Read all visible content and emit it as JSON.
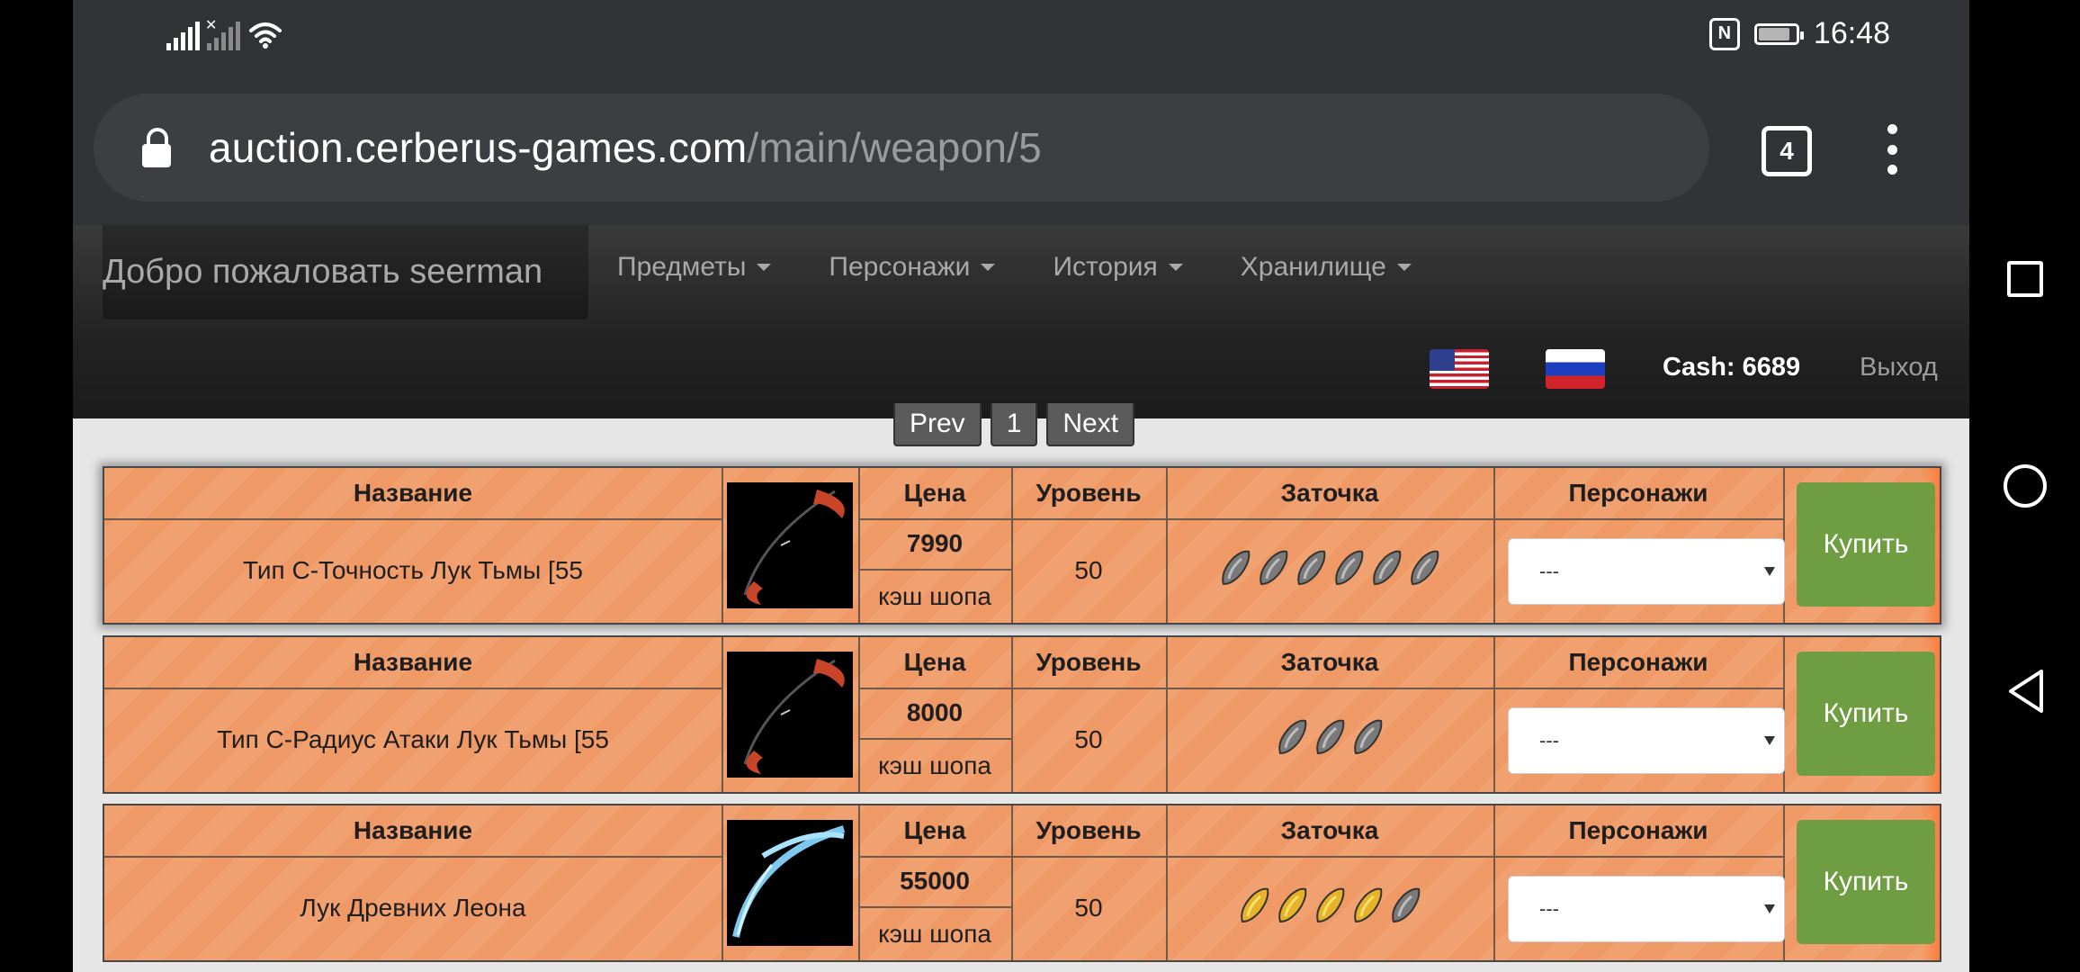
{
  "status_bar": {
    "time": "16:48",
    "nfc_label": "N"
  },
  "browser": {
    "url_host": "auction.cerberus-games.com",
    "url_path": "/main/weapon/5",
    "tab_count": "4"
  },
  "site": {
    "welcome": "Добро пожаловать seerman",
    "menu": [
      {
        "label": "Предметы"
      },
      {
        "label": "Персонажи"
      },
      {
        "label": "История"
      },
      {
        "label": "Хранилище"
      }
    ],
    "cash_label": "Cash: 6689",
    "logout_label": "Выход"
  },
  "pagination": {
    "prev": "Prev",
    "page": "1",
    "next": "Next"
  },
  "headers": {
    "name": "Название",
    "price": "Цена",
    "level": "Уровень",
    "enchant": "Заточка",
    "characters": "Персонажи"
  },
  "buy_label": "Купить",
  "items": [
    {
      "name": "Тип С-Точность Лук Тьмы [55",
      "price": "7990",
      "currency": "кэш шопа",
      "level": "50",
      "enchant_count": 6,
      "enchant_style": "gray",
      "select_value": "---"
    },
    {
      "name": "Тип С-Радиус Атаки Лук Тьмы [55",
      "price": "8000",
      "currency": "кэш шопа",
      "level": "50",
      "enchant_count": 3,
      "enchant_style": "gray",
      "select_value": "---"
    },
    {
      "name": "Лук Древних Леона",
      "price": "55000",
      "currency": "кэш шопа",
      "level": "50",
      "enchant_count": 5,
      "enchant_style": "gold",
      "select_value": "---"
    }
  ],
  "colors": {
    "buy_button": "#6f9d41",
    "row_background": "#f0a06a",
    "navbar": "#222222"
  }
}
